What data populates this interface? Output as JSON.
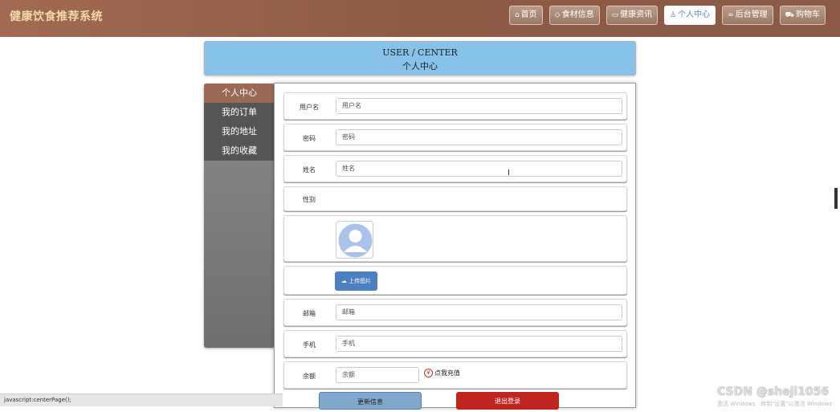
{
  "header": {
    "brand": "健康饮食推荐系统",
    "nav": [
      {
        "icon": "home-icon",
        "label": "首页",
        "active": false
      },
      {
        "icon": "tag-icon",
        "label": "食材信息",
        "active": false
      },
      {
        "icon": "news-icon",
        "label": "健康资讯",
        "active": false
      },
      {
        "icon": "user-icon",
        "label": "个人中心",
        "active": true
      },
      {
        "icon": "link-icon",
        "label": "后台管理",
        "active": false
      },
      {
        "icon": "cart-icon",
        "label": "购物车",
        "active": false
      }
    ]
  },
  "banner": {
    "title_en": "USER / CENTER",
    "title_zh": "个人中心"
  },
  "sidebar": {
    "items": [
      "个人中心",
      "我的订单",
      "我的地址",
      "我的收藏"
    ]
  },
  "form": {
    "username": {
      "label": "用户名",
      "placeholder": "用户名"
    },
    "password": {
      "label": "密码",
      "placeholder": "密码"
    },
    "name": {
      "label": "姓名",
      "placeholder": "姓名"
    },
    "gender": {
      "label": "性别"
    },
    "upload_label": "上传图片",
    "email": {
      "label": "邮箱",
      "placeholder": "邮箱"
    },
    "phone": {
      "label": "手机",
      "placeholder": "手机"
    },
    "balance": {
      "label": "余额",
      "placeholder": "余额"
    },
    "recharge_label": "点我充值",
    "update_button": "更新信息",
    "logout_button": "退出登录"
  },
  "status_bar": "javascript:centerPage();",
  "watermark": {
    "text": "CSDN @sheji1056",
    "sub": "激活 Windows · 转到\"设置\"以激活 Windows"
  },
  "colors": {
    "header": "#8e5a44",
    "brand_text": "#f1d9a8",
    "banner": "#86c2ea",
    "active_side": "#9a6a55",
    "logout": "#c0261f",
    "upload": "#4d80be"
  }
}
